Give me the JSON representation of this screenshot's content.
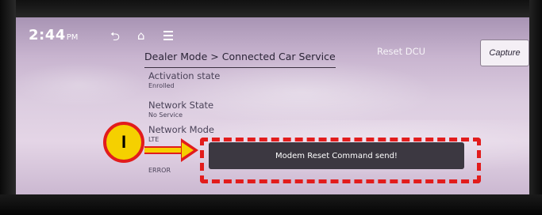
{
  "status_bar": {
    "time": "2:44",
    "ampm": "PM"
  },
  "nav_icons": [
    "back-icon",
    "home-icon",
    "menu-icon"
  ],
  "header": {
    "breadcrumb": "Dealer Mode > Connected Car Service",
    "reset_label": "Reset DCU",
    "capture_label": "Capture"
  },
  "fields": [
    {
      "label": "Activation state",
      "value": "Enrolled"
    },
    {
      "label": "Network State",
      "value": "No Service"
    },
    {
      "label": "Network Mode",
      "value": "LTE"
    },
    {
      "label": "",
      "value": "ERROR"
    }
  ],
  "toast": {
    "message": "Modem Reset Command send!"
  },
  "callout": {
    "label": "I"
  },
  "colors": {
    "highlight_red": "#e21c1c",
    "callout_yellow": "#f5d000",
    "toast_bg": "#3c3841"
  }
}
